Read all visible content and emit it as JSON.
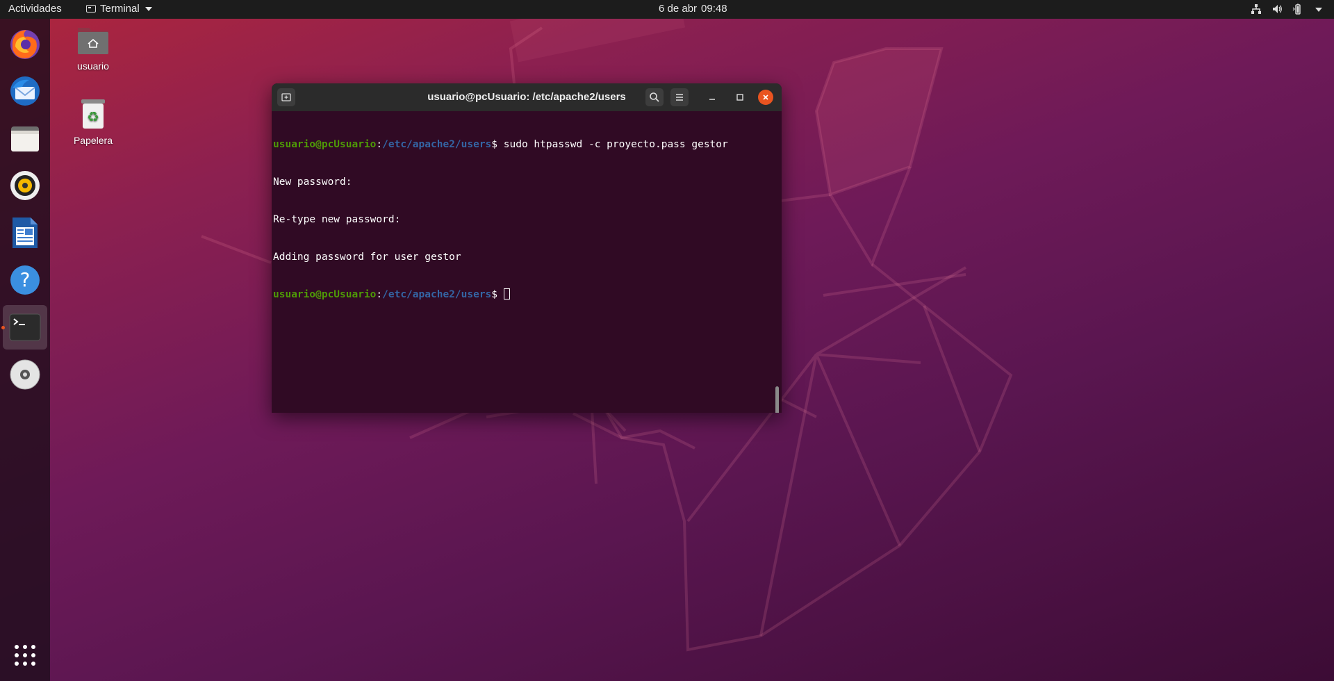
{
  "topbar": {
    "activities": "Actividades",
    "app_name": "Terminal",
    "date": "6 de abr",
    "time": "09:48"
  },
  "dock": {
    "items": [
      "firefox",
      "thunderbird",
      "files",
      "rhythmbox",
      "libreoffice-writer",
      "help",
      "terminal",
      "dvd"
    ],
    "active": "terminal"
  },
  "desktop": {
    "icons": [
      {
        "label": "usuario",
        "icon": "home-folder-icon"
      },
      {
        "label": "Papelera",
        "icon": "trash-icon"
      }
    ]
  },
  "terminal": {
    "title": "usuario@pcUsuario: /etc/apache2/users",
    "prompt_user": "usuario@pcUsuario",
    "prompt_sep": ":",
    "prompt_path": "/etc/apache2/users",
    "prompt_end": "$ ",
    "command": "sudo htpasswd -c proyecto.pass gestor",
    "output": [
      "New password:",
      "Re-type new password:",
      "Adding password for user gestor"
    ]
  },
  "colors": {
    "accent": "#e95420",
    "terminal_bg": "#300a24",
    "prompt_user": "#4e9a06",
    "prompt_path": "#3465a4"
  }
}
